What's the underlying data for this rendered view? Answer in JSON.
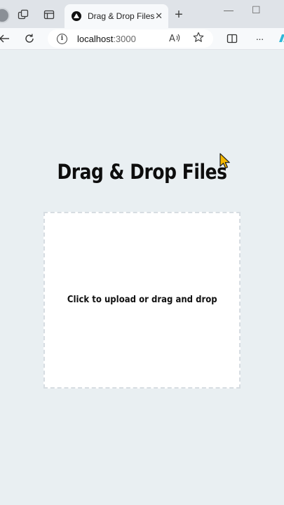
{
  "browser": {
    "tab": {
      "title": "Drag & Drop Files",
      "close_glyph": "✕"
    },
    "new_tab_glyph": "+",
    "window_controls": {
      "minimize": "—",
      "maximize": "☐"
    },
    "address": {
      "host": "localhost",
      "port": ":3000"
    },
    "icons": {
      "profile": "profile-avatar-icon",
      "workspaces": "workspaces-icon",
      "tab_actions": "tab-actions-icon",
      "back": "back-arrow-icon",
      "refresh": "refresh-icon",
      "info": "site-info-icon",
      "read_aloud": "read-aloud-icon",
      "favorites": "star-icon",
      "split_screen": "split-screen-icon",
      "more": "more-icon",
      "copilot": "copilot-icon"
    },
    "more_glyph": "···"
  },
  "page": {
    "title": "Drag & Drop Files",
    "dropzone": {
      "label": "Click to upload or drag and drop"
    }
  },
  "colors": {
    "page_background": "#e9eff2",
    "dropzone_background": "#ffffff",
    "dropzone_border": "#d7dde2",
    "cursor_fill": "#f5b800"
  }
}
